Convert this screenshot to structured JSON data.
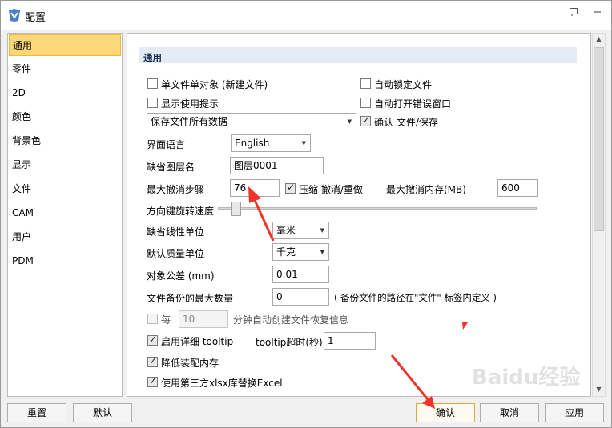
{
  "window": {
    "title": "配置",
    "pin_icon": "pin-icon",
    "minimize_icon": "minimize-icon"
  },
  "sidebar": {
    "items": [
      {
        "label": "通用",
        "selected": true
      },
      {
        "label": "零件"
      },
      {
        "label": "2D"
      },
      {
        "label": "颜色"
      },
      {
        "label": "背景色"
      },
      {
        "label": "显示"
      },
      {
        "label": "文件"
      },
      {
        "label": "CAM"
      },
      {
        "label": "用户"
      },
      {
        "label": "PDM"
      }
    ]
  },
  "section": {
    "title": "通用"
  },
  "options": {
    "single_file_single_object": {
      "label": "单文件单对象 (新建文件)",
      "checked": false
    },
    "show_tips": {
      "label": "显示使用提示",
      "checked": false
    },
    "auto_lock_file": {
      "label": "自动锁定文件",
      "checked": false
    },
    "auto_open_error_window": {
      "label": "自动打开错误窗口",
      "checked": false
    },
    "save_mode": {
      "value": "保存文件所有数据"
    },
    "confirm_file_save": {
      "label": "确认 文件/保存",
      "checked": true
    },
    "ui_language": {
      "label": "界面语言",
      "value": "English"
    },
    "default_layer_name": {
      "label": "缺省图层名",
      "value": "图层0001"
    },
    "max_undo_steps": {
      "label": "最大撤消步骤",
      "value": "76"
    },
    "compress_undo_redo": {
      "label": "压缩 撤消/重做",
      "checked": true
    },
    "max_undo_memory": {
      "label": "最大撤消内存(MB)",
      "value": "600"
    },
    "arrow_key_rotate_speed": {
      "label": "方向键旋转速度",
      "level": 0.05
    },
    "default_linear_unit": {
      "label": "缺省线性单位",
      "value": "毫米"
    },
    "default_mass_unit": {
      "label": "默认质量单位",
      "value": "千克"
    },
    "object_tolerance": {
      "label": "对象公差 (mm)",
      "value": "0.01"
    },
    "max_backup_count": {
      "label": "文件备份的最大数量",
      "value": "0",
      "note": "( 备份文件的路径在\"文件\" 标签内定义 )"
    },
    "autosave": {
      "prefix": "每",
      "value": "10",
      "suffix": "分钟自动创建文件恢复信息",
      "checked": false
    },
    "detailed_tooltip": {
      "label": "启用详细 tooltip",
      "checked": true
    },
    "tooltip_timeout": {
      "label": "tooltip超时(秒)",
      "value": "1"
    },
    "reduce_assembly_memory": {
      "label": "降低装配内存",
      "checked": true
    },
    "third_party_xlsx": {
      "label": "使用第三方xlsx库替换Excel",
      "checked": true
    }
  },
  "buttons": {
    "reset": "重置",
    "default": "默认",
    "ok": "确认",
    "cancel": "取消",
    "apply": "应用"
  },
  "watermark": "Baidu经验",
  "colors": {
    "selection": "#fcd87a",
    "section_header": "#e3ecf4",
    "annotation_arrow": "#f0342a"
  }
}
